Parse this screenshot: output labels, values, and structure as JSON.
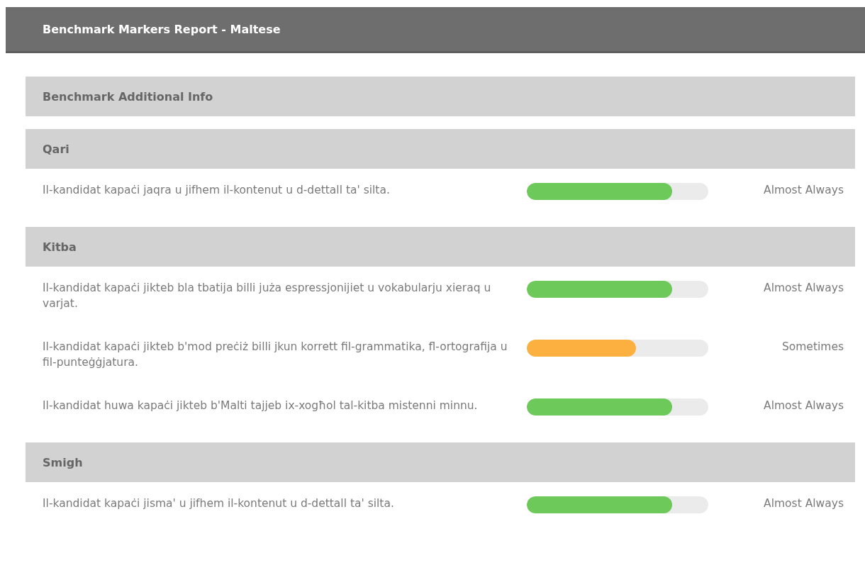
{
  "header": {
    "title": "Benchmark Markers Report - Maltese"
  },
  "sections": [
    {
      "title": "Benchmark Additional Info"
    },
    {
      "title": "Qari",
      "items": [
        {
          "text": "Il-kandidat kapaċi jaqra u jifhem il-kontenut u d-dettall ta' silta.",
          "level": 0.8,
          "color": "#6cc95a",
          "rating": "Almost Always"
        }
      ]
    },
    {
      "title": "Kitba",
      "items": [
        {
          "text": "Il-kandidat kapaċi jikteb bla tbatija billi juża espressjonijiet u vokabularju xieraq u varjat.",
          "level": 0.8,
          "color": "#6cc95a",
          "rating": "Almost Always"
        },
        {
          "text": "Il-kandidat kapaċi jikteb b'mod preċiż billi jkun korrett fil-grammatika, fl-ortografija u fil-punteġġjatura.",
          "level": 0.6,
          "color": "#fbb040",
          "rating": "Sometimes"
        },
        {
          "text": "Il-kandidat huwa kapaċi jikteb b'Malti tajjeb ix-xogħol tal-kitba mistenni minnu.",
          "level": 0.8,
          "color": "#6cc95a",
          "rating": "Almost Always"
        }
      ]
    },
    {
      "title": "Smigh",
      "items": [
        {
          "text": "Il-kandidat kapaċi jisma' u jifhem il-kontenut u d-dettall ta' silta.",
          "level": 0.8,
          "color": "#6cc95a",
          "rating": "Almost Always"
        }
      ]
    }
  ]
}
